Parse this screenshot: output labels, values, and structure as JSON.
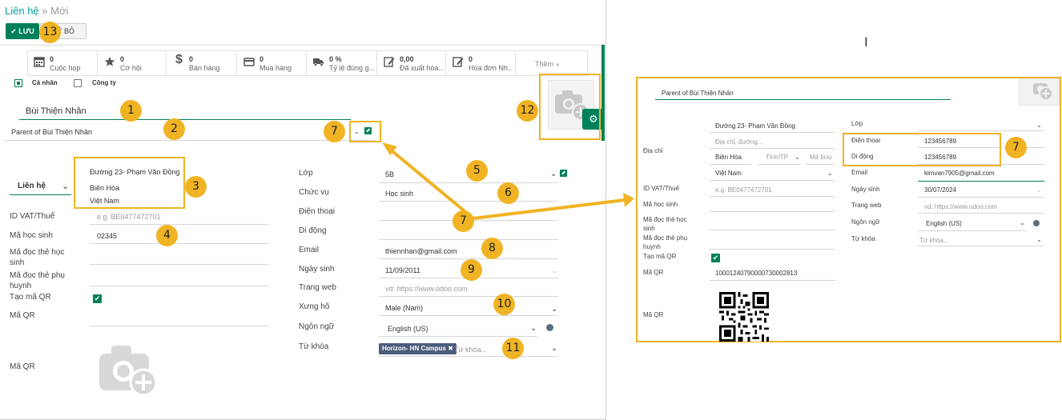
{
  "breadcrumb": {
    "parent": "Liên hệ",
    "separator": "»",
    "current": "Mới"
  },
  "buttons": {
    "save": "LƯU",
    "discard": "UỶ BỎ"
  },
  "stats": [
    {
      "value": "0",
      "label": "Cuộc họp",
      "icon": "calendar-icon"
    },
    {
      "value": "0",
      "label": "Cơ hội",
      "icon": "star-icon"
    },
    {
      "value": "0",
      "label": "Bán hàng",
      "icon": "dollar-icon"
    },
    {
      "value": "0",
      "label": "Mua hàng",
      "icon": "credit-card-icon"
    },
    {
      "value": "0 %",
      "label": "Tỷ lệ đúng g...",
      "icon": "truck-icon"
    },
    {
      "value": "0,00",
      "label": "Đã xuất hóa...",
      "icon": "pencil-square-icon"
    },
    {
      "value": "0",
      "label": "Hoá đơn Nh...",
      "icon": "pencil-square-icon"
    }
  ],
  "more_button": "Thêm",
  "company_type": {
    "individual": "Cá nhân",
    "company": "Công ty",
    "selected": "individual"
  },
  "form": {
    "name": "Bùi Thiện Nhân",
    "parent": "Parent of Bùi Thiện Nhân",
    "address_type": "Liên hệ",
    "address": {
      "street": "Đường 23- Phạm Văn Đồng",
      "city": "Biên Hòa",
      "country": "Việt Nam"
    },
    "labels": {
      "vat": "ID VAT/Thuế",
      "student_code": "Mã học sinh",
      "student_card": "Mã đọc thẻ học sinh",
      "parent_card": "Mã đọc thẻ phụ huynh",
      "gen_qr": "Tạo mã QR",
      "qr": "Mã QR",
      "qr2": "Mã QR",
      "class": "Lớp",
      "job": "Chức vụ",
      "phone": "Điện thoại",
      "mobile": "Di động",
      "email": "Email",
      "birthday": "Ngày sinh",
      "website": "Trang web",
      "title": "Xưng hô",
      "language": "Ngôn ngữ",
      "tags": "Từ khóa"
    },
    "vat_placeholder": "e.g. BE0477472701",
    "student_code": "02345",
    "class": "5B",
    "job": "Học sinh",
    "email": "thiennhan@gmail.com",
    "birthday": "11/09/2011",
    "website_placeholder": "vd: https://www.odoo.com",
    "title": "Male (Nam)",
    "language": "English (US)",
    "tag": "Horizon- HN Campus",
    "tags_placeholder": "Từ khóa..."
  },
  "callouts": [
    "1",
    "2",
    "3",
    "4",
    "5",
    "6",
    "7",
    "8",
    "9",
    "10",
    "11",
    "12",
    "13",
    "7",
    "7"
  ],
  "inset": {
    "parent": "Parent of Bùi Thiện Nhân",
    "labels": {
      "address": "Địa chỉ",
      "vat": "ID VAT/Thuế",
      "student_code": "Mã học sinh",
      "student_card": "Mã đọc thẻ học sinh",
      "parent_card": "Mã đọc thẻ phụ huynh",
      "gen_qr": "Tạo mã QR",
      "qr": "Mã QR",
      "qr2": "Mã QR",
      "class": "Lớp",
      "phone": "Điện thoại",
      "mobile": "Di động",
      "email": "Email",
      "birthday": "Ngày sinh",
      "website": "Trang web",
      "language": "Ngôn ngữ",
      "tags": "Từ khóa"
    },
    "street": "Đường 23- Phạm Văn Đồng",
    "street2_placeholder": "Địa chỉ, đường...",
    "city": "Biên Hòa",
    "state_placeholder": "Tỉnh/TP",
    "zip_placeholder": "Mã bưu",
    "country": "Việt Nam",
    "vat_placeholder": "e.g. BE0477472701",
    "qr_value": "10001240790000730002813",
    "phone": "123456789",
    "mobile": "123456789",
    "email": "kimvan7905@gmail.com",
    "birthday": "30/07/2024",
    "website_placeholder": "vd: https://www.odoo.com",
    "language": "English (US)",
    "tags_placeholder": "Từ khóa..."
  },
  "colors": {
    "accent": "#00a09d",
    "primary_button": "#00805a",
    "callout": "#f0b323",
    "tag_bg": "#4b5b7a"
  }
}
